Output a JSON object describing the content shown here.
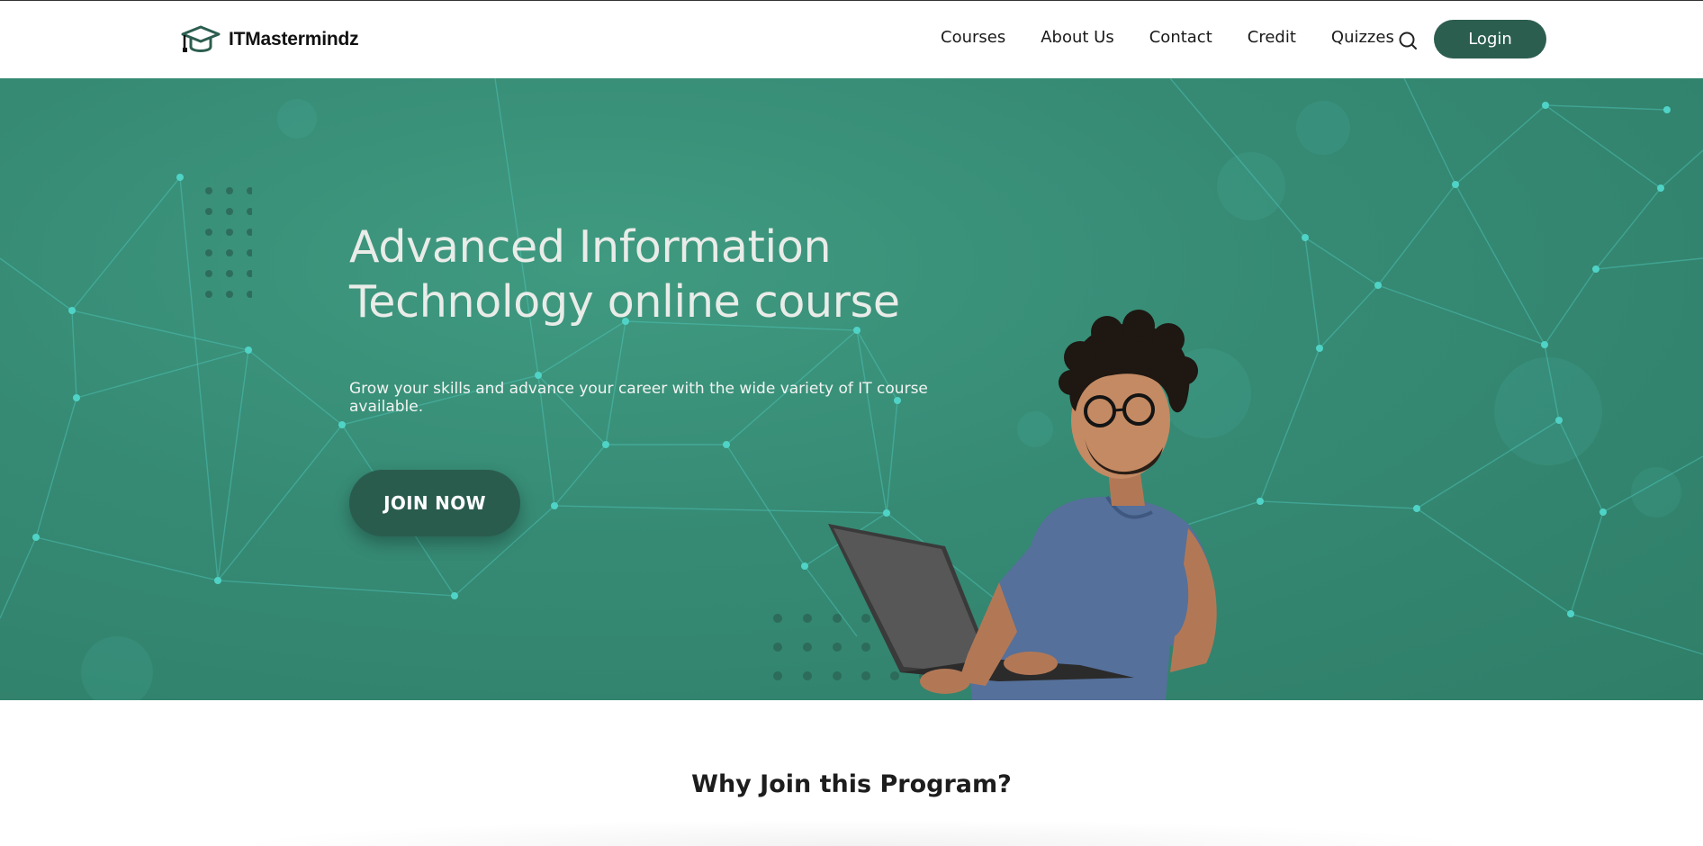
{
  "header": {
    "brand": "ITMastermindz",
    "nav": [
      "Courses",
      "About Us",
      "Contact",
      "Credit",
      "Quizzes"
    ],
    "login_label": "Login",
    "icons": {
      "logo": "graduation-cap-icon",
      "search": "search-icon"
    }
  },
  "hero": {
    "title_line1": "Advanced Information",
    "title_line2": "Technology online course",
    "subtitle": "Grow your skills and advance your career with the wide variety of IT course available.",
    "cta_label": "JOIN NOW"
  },
  "section": {
    "title": "Why Join this Program?"
  },
  "colors": {
    "brand_dark": "#2c5e50",
    "hero_bg": "#368a74",
    "network_line": "#4fc9be",
    "text_dark": "#1a1a1a"
  }
}
